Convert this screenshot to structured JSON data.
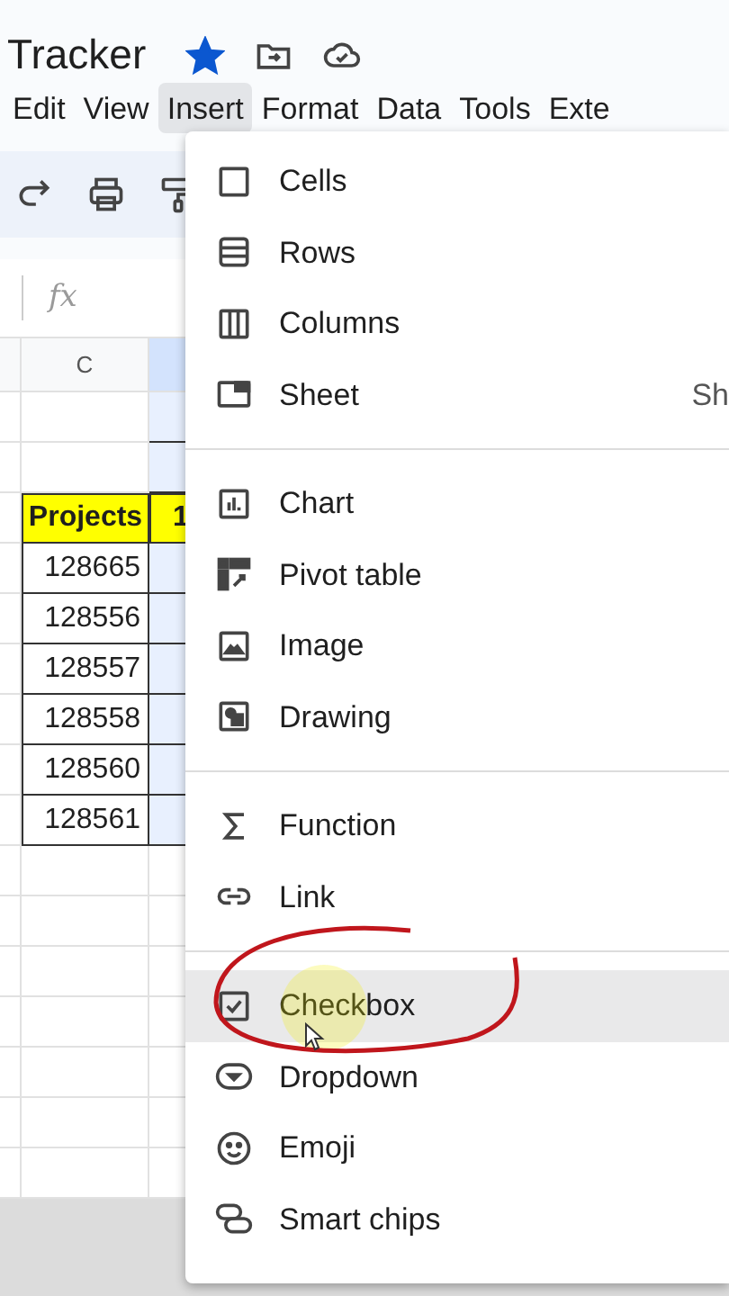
{
  "document": {
    "title": "Tracker",
    "starred": true
  },
  "menu_bar": [
    {
      "label": "Edit",
      "selected": false
    },
    {
      "label": "View",
      "selected": false
    },
    {
      "label": "Insert",
      "selected": true
    },
    {
      "label": "Format",
      "selected": false
    },
    {
      "label": "Data",
      "selected": false
    },
    {
      "label": "Tools",
      "selected": false
    },
    {
      "label": "Exte",
      "selected": false
    }
  ],
  "formula_bar": {
    "label": "fx"
  },
  "column_headers": [
    {
      "label": "C",
      "selected": false
    },
    {
      "selected": true
    }
  ],
  "table": {
    "header": [
      "Projects",
      "1"
    ],
    "rows": [
      "128665",
      "128556",
      "128557",
      "128558",
      "128560",
      "128561"
    ]
  },
  "insert_menu": [
    [
      {
        "label": "Cells",
        "highlighted": false
      },
      {
        "label": "Rows",
        "highlighted": false
      },
      {
        "label": "Columns",
        "highlighted": false
      },
      {
        "label": "Sheet",
        "shortcut": "Sh",
        "highlighted": false
      }
    ],
    [
      {
        "label": "Chart",
        "highlighted": false
      },
      {
        "label": "Pivot table",
        "highlighted": false
      },
      {
        "label": "Image",
        "highlighted": false
      },
      {
        "label": "Drawing",
        "highlighted": false
      }
    ],
    [
      {
        "label": "Function",
        "highlighted": false
      },
      {
        "label": "Link",
        "highlighted": false
      }
    ],
    [
      {
        "label": "Checkbox",
        "highlighted": true
      },
      {
        "label": "Dropdown",
        "highlighted": false
      },
      {
        "label": "Emoji",
        "highlighted": false
      },
      {
        "label": "Smart chips",
        "highlighted": false
      }
    ]
  ]
}
